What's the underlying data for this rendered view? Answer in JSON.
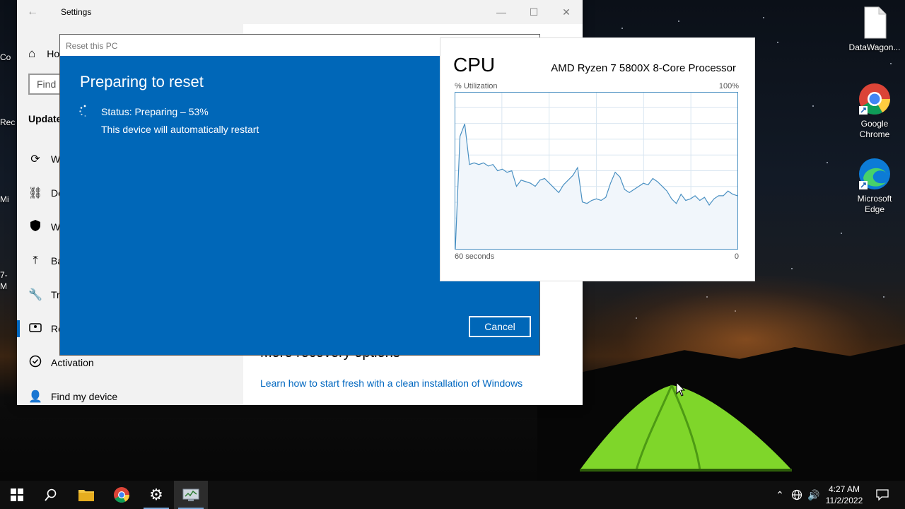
{
  "desktop": {
    "icons": [
      {
        "label": "DataWagon..."
      },
      {
        "label": "Google Chrome"
      },
      {
        "label": "Microsoft Edge"
      }
    ],
    "left_edge_labels": [
      "Co",
      "Rec",
      "Mi",
      "7-",
      "M"
    ]
  },
  "settings": {
    "window_title": "Settings",
    "home_label": "Ho",
    "find_placeholder": "Find",
    "section_label": "Update",
    "nav": [
      {
        "label": "W",
        "icon": "sync-icon"
      },
      {
        "label": "De",
        "icon": "delivery-icon"
      },
      {
        "label": "W",
        "icon": "shield-icon"
      },
      {
        "label": "Ba",
        "icon": "backup-icon"
      },
      {
        "label": "Tr",
        "icon": "wrench-icon"
      },
      {
        "label": "Re",
        "icon": "recovery-icon",
        "active": true
      },
      {
        "label": "Activation",
        "icon": "check-circle-icon"
      },
      {
        "label": "Find my device",
        "icon": "person-icon"
      }
    ],
    "content": {
      "more_options_title": "More recovery options",
      "learn_link": "Learn how to start fresh with a clean installation of Windows"
    }
  },
  "reset_dialog": {
    "title": "Reset this PC",
    "heading": "Preparing to reset",
    "status": "Status: Preparing – 53%",
    "progress_percent": 53,
    "note": "This device will automatically restart",
    "cancel_label": "Cancel"
  },
  "cpu_panel": {
    "title": "CPU",
    "processor": "AMD Ryzen 7 5800X 8-Core Processor",
    "y_label": "% Utilization",
    "y_max_label": "100%",
    "x_label": "60 seconds",
    "x_end_label": "0"
  },
  "chart_data": {
    "type": "area",
    "xlabel": "60 seconds",
    "ylabel": "% Utilization",
    "ylim": [
      0,
      100
    ],
    "xlim": [
      60,
      0
    ],
    "grid": true,
    "x": [
      60,
      59,
      58,
      57,
      56,
      55,
      54,
      53,
      52,
      51,
      50,
      49,
      48,
      47,
      46,
      45,
      44,
      43,
      42,
      41,
      40,
      39,
      38,
      37,
      36,
      35,
      34,
      33,
      32,
      31,
      30,
      29,
      28,
      27,
      26,
      25,
      24,
      23,
      22,
      21,
      20,
      19,
      18,
      17,
      16,
      15,
      14,
      13,
      12,
      11,
      10,
      9,
      8,
      7,
      6,
      5,
      4,
      3,
      2,
      1,
      0
    ],
    "values": [
      0,
      72,
      80,
      54,
      55,
      54,
      55,
      53,
      54,
      50,
      51,
      49,
      50,
      40,
      44,
      43,
      42,
      40,
      44,
      45,
      42,
      39,
      36,
      41,
      44,
      47,
      52,
      30,
      29,
      31,
      32,
      31,
      33,
      42,
      49,
      46,
      38,
      36,
      38,
      40,
      42,
      41,
      45,
      43,
      40,
      37,
      32,
      29,
      35,
      31,
      32,
      34,
      31,
      33,
      28,
      32,
      34,
      34,
      37,
      35,
      34
    ],
    "color": "#4a90c2"
  },
  "taskbar": {
    "clock_time": "4:27 AM",
    "clock_date": "11/2/2022"
  }
}
